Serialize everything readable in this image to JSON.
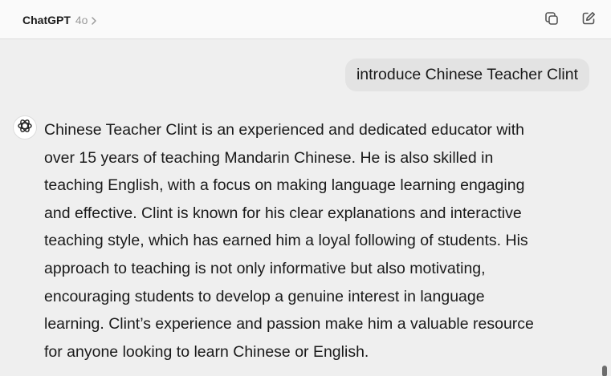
{
  "header": {
    "app_title": "ChatGPT",
    "model_version": "4o",
    "chevron_icon": "chevron-right-icon",
    "copy_icon": "copy-icon",
    "compose_icon": "new-chat-icon"
  },
  "conversation": {
    "user_message": "introduce Chinese Teacher Clint",
    "assistant_icon": "chatgpt-logo-icon",
    "assistant_lines": [
      "Chinese Teacher Clint is an experienced and dedicated educator with",
      "over 15 years of teaching Mandarin Chinese. He is also skilled in",
      "teaching English, with a focus on making language learning engaging",
      "and effective. Clint is known for his clear explanations and interactive",
      "teaching style, which has earned him a loyal following of students. His",
      "approach to teaching is not only informative but also motivating,",
      "encouraging students to develop a genuine interest in language",
      "learning. Clint’s experience and passion make him a valuable resource",
      "for anyone looking to learn Chinese or English."
    ]
  },
  "colors": {
    "background": "#efefef",
    "titlebar": "#fafafa",
    "user_bubble": "#e3e3e3",
    "text": "#1a1a1a",
    "muted": "#9a9a9a"
  }
}
